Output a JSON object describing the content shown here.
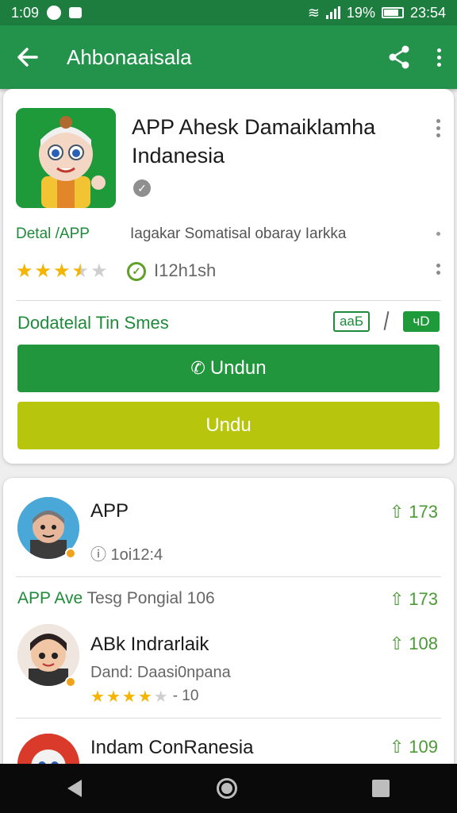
{
  "status_bar": {
    "time_left": "1:09",
    "battery": "19%",
    "clock": "23:54"
  },
  "app_bar": {
    "title": "Ahbonaaisala"
  },
  "app": {
    "title": "APP Ahesk Damaiklamha Indanesia",
    "detail_label": "Detal /APP",
    "detail_text": "Iagakar Somatisal obaray Iarkka",
    "rating": 3.5,
    "rating_text": "I12h1sh",
    "section_title": "Dodatelal Tin Smes",
    "tag_outline": "aаБ",
    "tag_filled": "чD",
    "btn_primary": "Undun",
    "btn_secondary": "Undu"
  },
  "list": {
    "item1": {
      "title": "APP",
      "sub": "ⓘ 1oi12:4",
      "count": "173"
    },
    "section": {
      "label": "APP Ave",
      "extra": "Tesg Pongial 106",
      "count": "173"
    },
    "item2": {
      "title": "ABk Indrarlaik",
      "sub": "Dand: Daasi0npana",
      "rating": 4,
      "rating_extra": "- 10",
      "count": "108"
    },
    "item3": {
      "title": "Indam ConRanesia",
      "count": "109"
    }
  },
  "colors": {
    "brand": "#23924b",
    "accent_green": "#21963c",
    "lime": "#b7c50c",
    "star": "#f4b400"
  }
}
